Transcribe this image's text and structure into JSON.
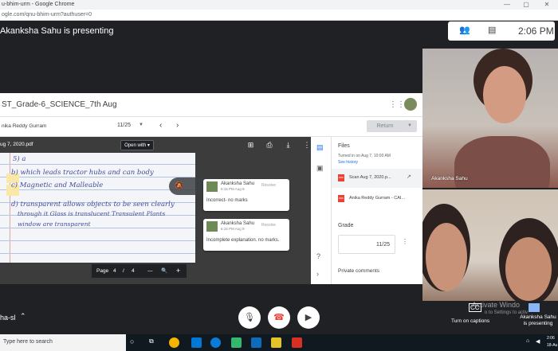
{
  "browser": {
    "window_title": "u-bhim-urm - Google Chrome",
    "url": "ogle.com/qnu-bhim-urm?authuser=0"
  },
  "meet": {
    "presenting_banner": "Akanksha Sahu is presenting",
    "time": "2:06 PM",
    "meeting_code": "ha-sl",
    "captions_label": "Turn on captions",
    "captions_icon": "CC",
    "presenting_label": "Akanksha Sahu is presenting"
  },
  "classroom": {
    "assignment_title": "ST_Grade-6_SCIENCE_7th Aug",
    "student_name": "nika Reddy Gurram",
    "score_display": "11/25",
    "return_label": "Return",
    "pdf_name": "ug 7, 2020.pdf",
    "open_with_label": "Open with",
    "page_label": "Page",
    "page_current": "4",
    "page_sep": "/",
    "page_total": "4",
    "zoom_out": "—",
    "zoom_in": "+",
    "handwriting": [
      "5) a",
      "b) which leads tractor hubs and can body",
      "c) Magnetic and Malleable",
      "d) transparent allows objects to be seen clearly",
      "through it Glass is translucent Transulent Plants",
      "window are transparent"
    ],
    "comments": [
      {
        "author": "Akanksha Sahu",
        "time": "6:15 PM Aug 9",
        "resolve": "Resolve",
        "text": "Incorrect- no marks"
      },
      {
        "author": "Akanksha Sahu",
        "time": "6:15 PM Aug 9",
        "resolve": "Resolve",
        "text": "Incomplete explanation. no marks."
      }
    ],
    "files": {
      "title": "Files",
      "turned_in": "Turned in on Aug 7, 10:00 AM",
      "see_history": "See history",
      "items": [
        {
          "name": "Scan Aug 7, 2020.p...",
          "icon": "pdf-icon"
        },
        {
          "name": "Anika Reddy Gurram - CAI...",
          "icon": "pdf-icon"
        }
      ],
      "file_badge": "PDF"
    },
    "grade": {
      "title": "Grade",
      "value": "11/25"
    },
    "private_comments": "Private comments"
  },
  "participants": {
    "presenter": "Akanksha Sahu"
  },
  "windows_watermark": {
    "title": "Activate Windo",
    "subtitle": "o to Settings to activ"
  },
  "taskbar": {
    "search_placeholder": "Type here to search",
    "time": "2:06",
    "date": "18-Au"
  }
}
